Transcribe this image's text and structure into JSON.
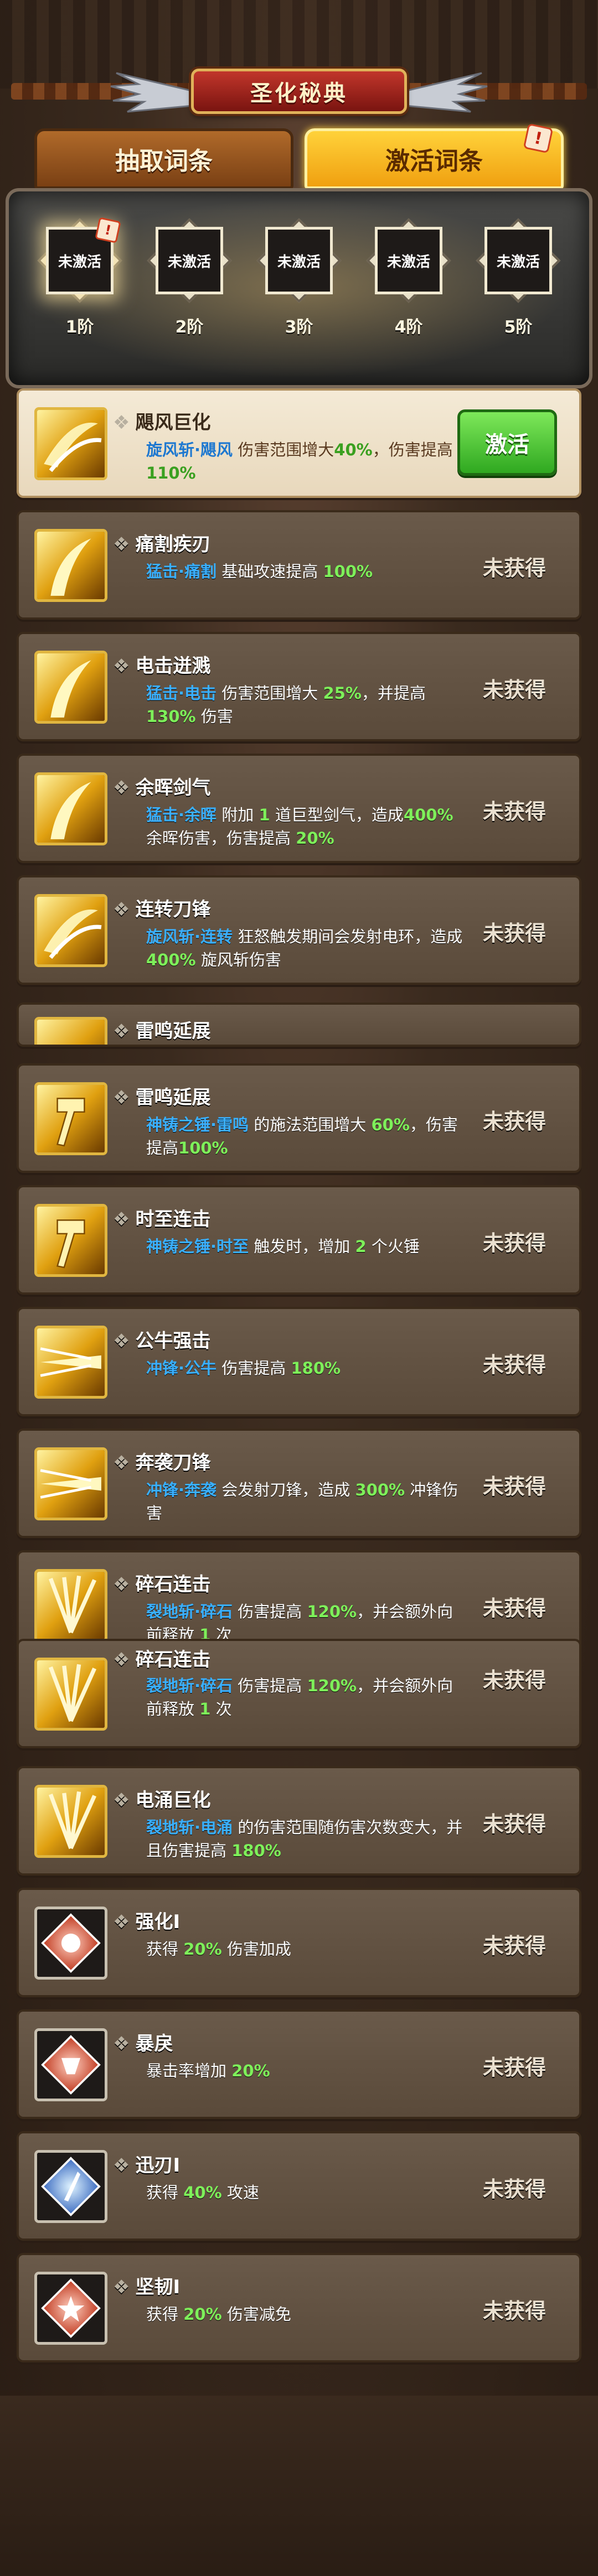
{
  "header": {
    "title": "圣化秘典"
  },
  "tabs": [
    {
      "label": "抽取词条",
      "active": false
    },
    {
      "label": "激活词条",
      "active": true,
      "badge": "!"
    }
  ],
  "tiers": [
    {
      "box": "未激活",
      "label": "1阶"
    },
    {
      "box": "未激活",
      "label": "2阶"
    },
    {
      "box": "未激活",
      "label": "3阶"
    },
    {
      "box": "未激活",
      "label": "4阶"
    },
    {
      "box": "未激活",
      "label": "5阶"
    }
  ],
  "status": {
    "unobtained": "未获得",
    "activate": "激活"
  },
  "colors": {
    "skill": "#3ab0ff",
    "number": "#7ef05a",
    "accent_gold": "#e0b640",
    "button_green": "#2fa820"
  },
  "entries": [
    {
      "title": "飓风巨化",
      "icon": "tornado-icon",
      "d1": "旋风斩·飓风",
      "d2": "伤害范围增大",
      "d3": "40%",
      "d4": "，伤害提高",
      "d5": "110%"
    },
    {
      "title": "痛割疾刃",
      "icon": "slash-icon",
      "d1": "猛击·痛割",
      "d2": "基础攻速提高",
      "d3": "100%"
    },
    {
      "title": "电击迸溅",
      "icon": "slash-icon",
      "d1": "猛击·电击",
      "d2": "伤害范围增大",
      "d3": "25%",
      "d4": "，并提高",
      "d5": "130%",
      "d6": "伤害"
    },
    {
      "title": "余晖剑气",
      "icon": "slash-icon",
      "d1": "猛击·余晖",
      "d2": "附加",
      "d3": "1",
      "d4": "道巨型剑气，造成",
      "d5": "400%",
      "d6": "余晖伤害，伤害提高",
      "d7": "20%"
    },
    {
      "title": "连转刀锋",
      "icon": "tornado-icon",
      "d1": "旋风斩·连转",
      "d2": "狂怒触发期间会发射电环，造成",
      "d3": "400%",
      "d4": "旋风斩伤害"
    },
    {
      "title": "雷鸣延展",
      "icon": "hammer-icon"
    },
    {
      "title": "雷鸣延展",
      "icon": "hammer-icon",
      "d1": "神铸之锤·雷鸣",
      "d2": "的施法范围增大",
      "d3": "60%",
      "d4": "，伤害提高",
      "d5": "100%"
    },
    {
      "title": "时至连击",
      "icon": "hammer-icon",
      "d1": "神铸之锤·时至",
      "d2": "触发时，增加",
      "d3": "2",
      "d4": "个火锤"
    },
    {
      "title": "公牛强击",
      "icon": "charge-icon",
      "d1": "冲锋·公牛",
      "d2": "伤害提高",
      "d3": "180%"
    },
    {
      "title": "奔袭刀锋",
      "icon": "charge-icon",
      "d1": "冲锋·奔袭",
      "d2": "会发射刀锋，造成",
      "d3": "300%",
      "d4": "冲锋伤害"
    },
    {
      "title": "碎石连击",
      "icon": "shatter-icon",
      "d1": "裂地斩·碎石",
      "d2": "伤害提高",
      "d3": "120%",
      "d4": "，并会额外向前释放",
      "d5": "1",
      "d6": "次"
    },
    {
      "title": "碎石连击",
      "icon": "shatter-icon",
      "d1": "裂地斩·碎石",
      "d2": "伤害提高",
      "d3": "120%",
      "d4": "，并会额外向前释放",
      "d5": "1",
      "d6": "次"
    },
    {
      "title": "电涌巨化",
      "icon": "shatter-icon",
      "d1": "裂地斩·电涌",
      "d2": "的伤害范围随伤害次数变大，并且伤害提高",
      "d3": "180%"
    },
    {
      "title": "强化I",
      "icon": "fist-icon",
      "d1": "获得",
      "d2": "20%",
      "d3": "伤害加成"
    },
    {
      "title": "暴戾",
      "icon": "crit-icon",
      "d1": "暴击率增加",
      "d2": "20%"
    },
    {
      "title": "迅刃I",
      "icon": "swift-blade-icon",
      "d1": "获得",
      "d2": "40%",
      "d3": "攻速"
    },
    {
      "title": "坚韧I",
      "icon": "shield-star-icon",
      "d1": "获得",
      "d2": "20%",
      "d3": "伤害减免"
    }
  ]
}
